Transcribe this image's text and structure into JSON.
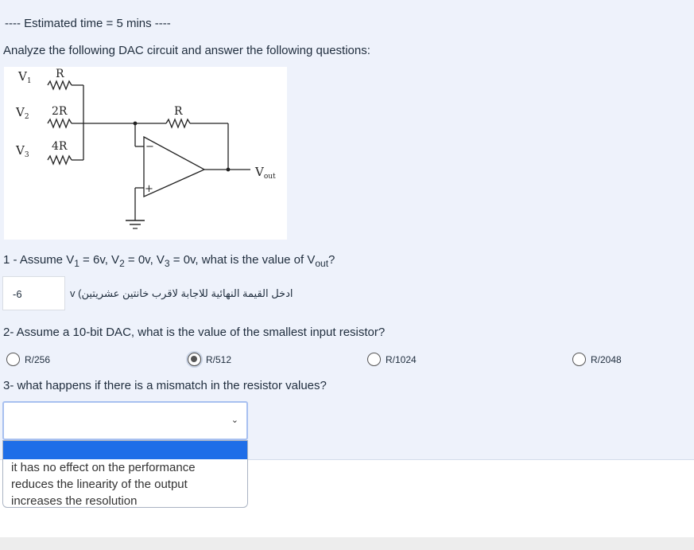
{
  "header": {
    "estimated_time": "---- Estimated time = 5 mins ----"
  },
  "intro": "Analyze the following DAC circuit and answer the following questions:",
  "diagram": {
    "v1": "V",
    "v1_sub": "1",
    "v2": "V",
    "v2_sub": "2",
    "v3": "V",
    "v3_sub": "3",
    "r1": "R",
    "r2": "2R",
    "r3": "4R",
    "rf": "R",
    "minus": "−",
    "plus": "+",
    "vout": "V",
    "vout_sub": "out"
  },
  "q1": {
    "prefix": "1 - Assume V",
    "s1": "1",
    "mid1": " = 6v, V",
    "s2": "2",
    "mid2": " = 0v, V",
    "s3": "3",
    "mid3": " = 0v, what is the value of V",
    "s4": "out",
    "suffix": "?",
    "answer": "-6",
    "unit_hint": "ادخل القيمة النهائية للاجابة لاقرب خانتين عشريتين) v"
  },
  "q2": {
    "text": "2- Assume a 10-bit DAC, what is the value of the smallest input resistor?",
    "options": [
      "R/256",
      "R/512",
      "R/1024",
      "R/2048"
    ],
    "selected": "R/512"
  },
  "q3": {
    "text": "3- what happens if there is a mismatch in the resistor values?",
    "selected_value": "",
    "options": [
      "it has no effect on the performance",
      "reduces the linearity of the output",
      "increases the resolution"
    ]
  }
}
